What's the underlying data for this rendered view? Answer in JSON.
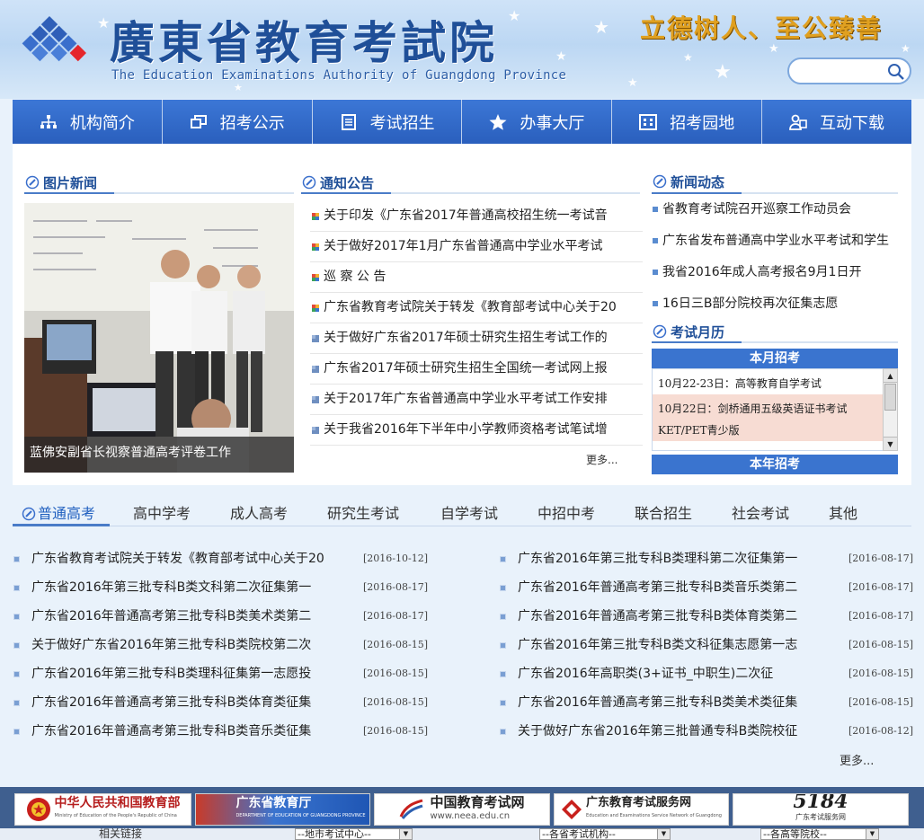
{
  "header": {
    "title_cn": "廣東省教育考試院",
    "title_en": "The Education Examinations Authority of Guangdong Province",
    "slogan": "立德树人、至公臻善",
    "search_placeholder": ""
  },
  "nav": [
    {
      "label": "机构简介",
      "icon": "org-chart-icon"
    },
    {
      "label": "招考公示",
      "icon": "window-icon"
    },
    {
      "label": "考试招生",
      "icon": "document-list-icon"
    },
    {
      "label": "办事大厅",
      "icon": "star-icon"
    },
    {
      "label": "招考园地",
      "icon": "grid-icon"
    },
    {
      "label": "互动下载",
      "icon": "users-icon"
    }
  ],
  "photo_news": {
    "title": "图片新闻",
    "caption": "蓝佛安副省长视察普通高考评卷工作"
  },
  "notices": {
    "title": "通知公告",
    "items": [
      "关于印发《广东省2017年普通高校招生统一考试音",
      "关于做好2017年1月广东省普通高中学业水平考试",
      "巡 察 公 告",
      "广东省教育考试院关于转发《教育部考试中心关于20",
      "关于做好广东省2017年硕士研究生招生考试工作的",
      "广东省2017年硕士研究生招生全国统一考试网上报",
      "关于2017年广东省普通高中学业水平考试工作安排",
      "关于我省2016年下半年中小学教师资格考试笔试增"
    ],
    "more": "更多..."
  },
  "news": {
    "title": "新闻动态",
    "items": [
      "省教育考试院召开巡察工作动员会",
      "广东省发布普通高中学业水平考试和学生",
      "我省2016年成人高考报名9月1日开",
      "16日三B部分院校再次征集志愿"
    ]
  },
  "calendar": {
    "title": "考试月历",
    "month_header": "本月招考",
    "year_header": "本年招考",
    "events": [
      {
        "text": "10月22-23日：高等教育自学考试"
      },
      {
        "text": "10月22日：剑桥通用五级英语证书考试"
      },
      {
        "text": "KET/PET青少版"
      }
    ]
  },
  "tabs": [
    "普通高考",
    "高中学考",
    "成人高考",
    "研究生考试",
    "自学考试",
    "中招中考",
    "联合招生",
    "社会考试",
    "其他"
  ],
  "articles_left": [
    {
      "title": "广东省教育考试院关于转发《教育部考试中心关于20",
      "date": "[2016-10-12]"
    },
    {
      "title": "广东省2016年第三批专科B类文科第二次征集第一",
      "date": "[2016-08-17]"
    },
    {
      "title": "广东省2016年普通高考第三批专科B类美术类第二",
      "date": "[2016-08-17]"
    },
    {
      "title": "关于做好广东省2016年第三批专科B类院校第二次",
      "date": "[2016-08-15]"
    },
    {
      "title": "广东省2016年第三批专科B类理科征集第一志愿投",
      "date": "[2016-08-15]"
    },
    {
      "title": "广东省2016年普通高考第三批专科B类体育类征集",
      "date": "[2016-08-15]"
    },
    {
      "title": "广东省2016年普通高考第三批专科B类音乐类征集",
      "date": "[2016-08-15]"
    }
  ],
  "articles_right": [
    {
      "title": "广东省2016年第三批专科B类理科第二次征集第一",
      "date": "[2016-08-17]"
    },
    {
      "title": "广东省2016年普通高考第三批专科B类音乐类第二",
      "date": "[2016-08-17]"
    },
    {
      "title": "广东省2016年普通高考第三批专科B类体育类第二",
      "date": "[2016-08-17]"
    },
    {
      "title": "广东省2016年第三批专科B类文科征集志愿第一志",
      "date": "[2016-08-15]"
    },
    {
      "title": "广东省2016年高职类(3+证书_中职生)二次征",
      "date": "[2016-08-15]"
    },
    {
      "title": "广东省2016年普通高考第三批专科B类美术类征集",
      "date": "[2016-08-15]"
    },
    {
      "title": "关于做好广东省2016年第三批普通专科B类院校征",
      "date": "[2016-08-12]"
    }
  ],
  "articles_more": "更多...",
  "footer": {
    "banners": [
      {
        "label": "中华人民共和国教育部",
        "sub": "Ministry of Education of the People's Republic of China"
      },
      {
        "label": "广东省教育厅",
        "sub": "DEPARTMENT OF EDUCATION OF GUANGDONG PROVINCE"
      },
      {
        "label": "中国教育考试网",
        "sub": "www.neea.edu.cn"
      },
      {
        "label": "广东教育考试服务网",
        "sub": "Education and Examinations Service Network of Guangdong"
      },
      {
        "label": "5184",
        "sub": "广东考试服务网"
      }
    ],
    "links_label": "相关链接",
    "selects": [
      "--地市考试中心--",
      "--各省考试机构--",
      "--各高等院校--"
    ]
  },
  "colors": {
    "nav_blue": "#2e66c4",
    "accent_blue": "#3a74cf",
    "slogan_gold": "#e0a020",
    "footer_blue": "#3f5f8f"
  }
}
